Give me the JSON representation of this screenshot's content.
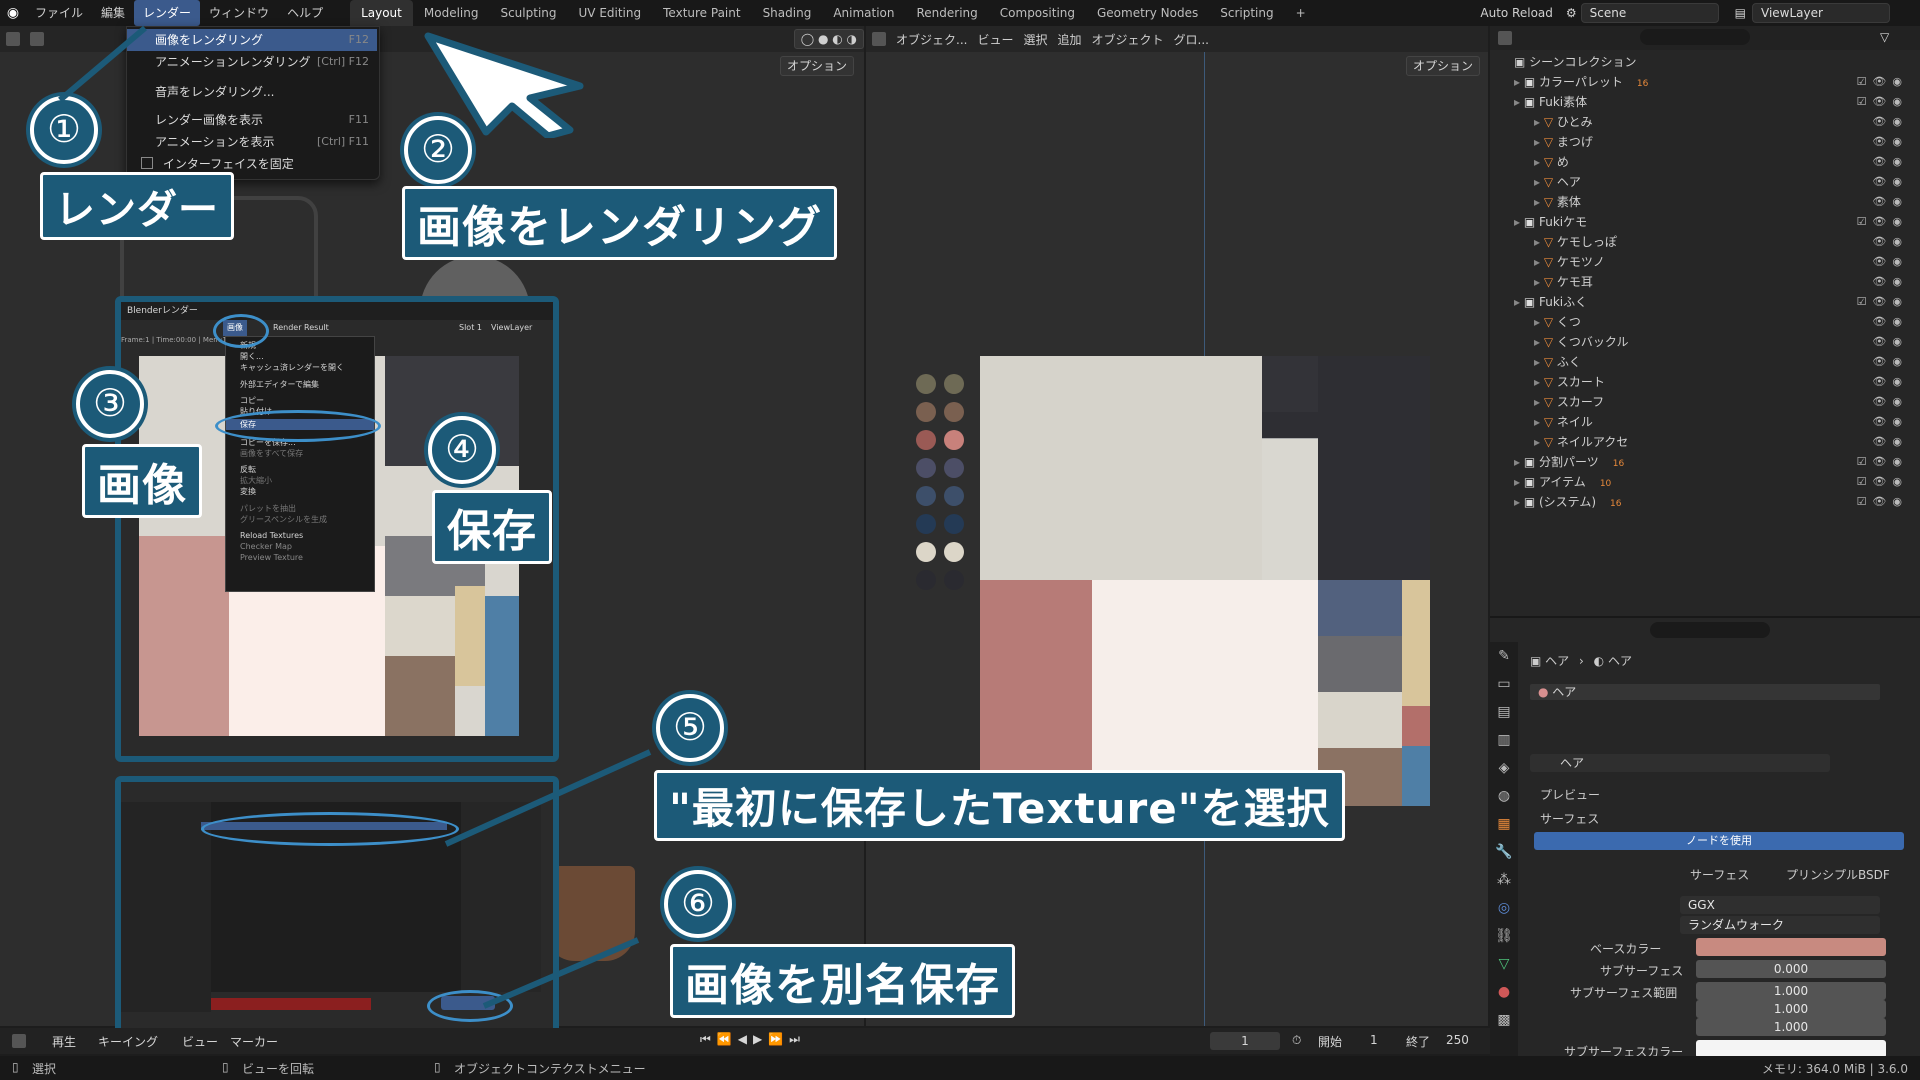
{
  "topbar": {
    "menus": [
      "ファイル",
      "編集",
      "レンダー",
      "ウィンドウ",
      "ヘルプ"
    ],
    "workspaces": [
      "Layout",
      "Modeling",
      "Sculpting",
      "UV Editing",
      "Texture Paint",
      "Shading",
      "Animation",
      "Rendering",
      "Compositing",
      "Geometry Nodes",
      "Scripting"
    ],
    "plus": "+",
    "auto_reload": "Auto Reload",
    "scene": "Scene",
    "view_layer": "ViewLayer"
  },
  "render_menu": {
    "items": [
      {
        "label": "画像をレンダリング",
        "shortcut": "F12"
      },
      {
        "label": "アニメーションレンダリング",
        "shortcut": "[Ctrl] F12"
      },
      {
        "label": "音声をレンダリング...",
        "shortcut": ""
      },
      {
        "label": "レンダー画像を表示",
        "shortcut": "F11"
      },
      {
        "label": "アニメーションを表示",
        "shortcut": "[Ctrl] F11"
      },
      {
        "label": "インターフェイスを固定",
        "shortcut": ""
      }
    ]
  },
  "left_viewport": {
    "options": "オプション"
  },
  "right_viewport": {
    "header": [
      "オブジェク...",
      "ビュー",
      "選択",
      "追加",
      "オブジェクト",
      "グロ..."
    ],
    "options": "オプション"
  },
  "annotations": {
    "n1": "①",
    "t1": "レンダー",
    "n2": "②",
    "t2": "画像をレンダリング",
    "n3": "③",
    "t3": "画像",
    "n4": "④",
    "t4": "保存",
    "n5": "⑤",
    "t5": "\"最初に保存したTexture\"を選択",
    "n6": "⑥",
    "t6": "画像を別名保存"
  },
  "render_window": {
    "title": "Blenderレンダー",
    "image_menu": "画像",
    "render_result": "Render Result",
    "slot": "Slot 1",
    "view_layer": "ViewLayer",
    "frame_info": "Frame:1 | Time:00:00 | Mem:1",
    "menu_items": [
      "新規",
      "開く...",
      "キャッシュ済レンダーを開く",
      "外部エディターで編集",
      "コピー",
      "貼り付け",
      "保存",
      "コピーを保存...",
      "画像をすべて保存",
      "反転",
      "拡大縮小",
      "変換",
      "パレットを抽出",
      "グリースペンシルを生成",
      "Reload Textures",
      "Checker Map",
      "Preview Texture"
    ]
  },
  "outliner": {
    "root": "シーンコレクション",
    "rows": [
      {
        "label": "カラーパレット",
        "indent": 1,
        "badge": "16"
      },
      {
        "label": "Fuki素体",
        "indent": 1,
        "badge": ""
      },
      {
        "label": "ひとみ",
        "indent": 2,
        "badge": ""
      },
      {
        "label": "まつげ",
        "indent": 2,
        "badge": ""
      },
      {
        "label": "め",
        "indent": 2,
        "badge": ""
      },
      {
        "label": "ヘア",
        "indent": 2,
        "badge": ""
      },
      {
        "label": "素体",
        "indent": 2,
        "badge": ""
      },
      {
        "label": "Fukiケモ",
        "indent": 1,
        "badge": ""
      },
      {
        "label": "ケモしっぽ",
        "indent": 2,
        "badge": ""
      },
      {
        "label": "ケモツノ",
        "indent": 2,
        "badge": ""
      },
      {
        "label": "ケモ耳",
        "indent": 2,
        "badge": ""
      },
      {
        "label": "Fukiふく",
        "indent": 1,
        "badge": ""
      },
      {
        "label": "くつ",
        "indent": 2,
        "badge": ""
      },
      {
        "label": "くつバックル",
        "indent": 2,
        "badge": ""
      },
      {
        "label": "ふく",
        "indent": 2,
        "badge": ""
      },
      {
        "label": "スカート",
        "indent": 2,
        "badge": ""
      },
      {
        "label": "スカーフ",
        "indent": 2,
        "badge": ""
      },
      {
        "label": "ネイル",
        "indent": 2,
        "badge": ""
      },
      {
        "label": "ネイルアクセ",
        "indent": 2,
        "badge": ""
      },
      {
        "label": "分割パーツ",
        "indent": 1,
        "badge": "16"
      },
      {
        "label": "アイテム",
        "indent": 1,
        "badge": "10"
      },
      {
        "label": "(システム)",
        "indent": 1,
        "badge": "16"
      }
    ]
  },
  "properties": {
    "breadcrumb_obj": "ヘア",
    "breadcrumb_mat": "ヘア",
    "slot": "ヘア",
    "material": "ヘア",
    "preview": "プレビュー",
    "surface_section": "サーフェス",
    "use_nodes": "ノードを使用",
    "surface_label": "サーフェス",
    "surface_value": "プリンシプルBSDF",
    "dist1": "GGX",
    "dist2": "ランダムウォーク",
    "base_color": "ベースカラー",
    "subsurface": "サブサーフェス",
    "subsurface_value": "0.000",
    "subsurface_radius": "サブサーフェス範囲",
    "r1": "1.000",
    "r2": "1.000",
    "r3": "1.000",
    "subsurface_color": "サブサーフェスカラー"
  },
  "timeline": {
    "items": [
      "再生",
      "キーイング",
      "ビュー",
      "マーカー"
    ],
    "frame": "1",
    "start_label": "開始",
    "start": "1",
    "end_label": "終了",
    "end": "250"
  },
  "statusbar": {
    "select": "選択",
    "rotate": "ビューを回転",
    "context": "オブジェクトコンテクストメニュー",
    "memory": "メモリ: 364.0 MiB | 3.6.0"
  },
  "colors": {
    "annotation": "#1c5a78",
    "highlight": "#3b5a8c",
    "base_color": "#c88a80"
  }
}
